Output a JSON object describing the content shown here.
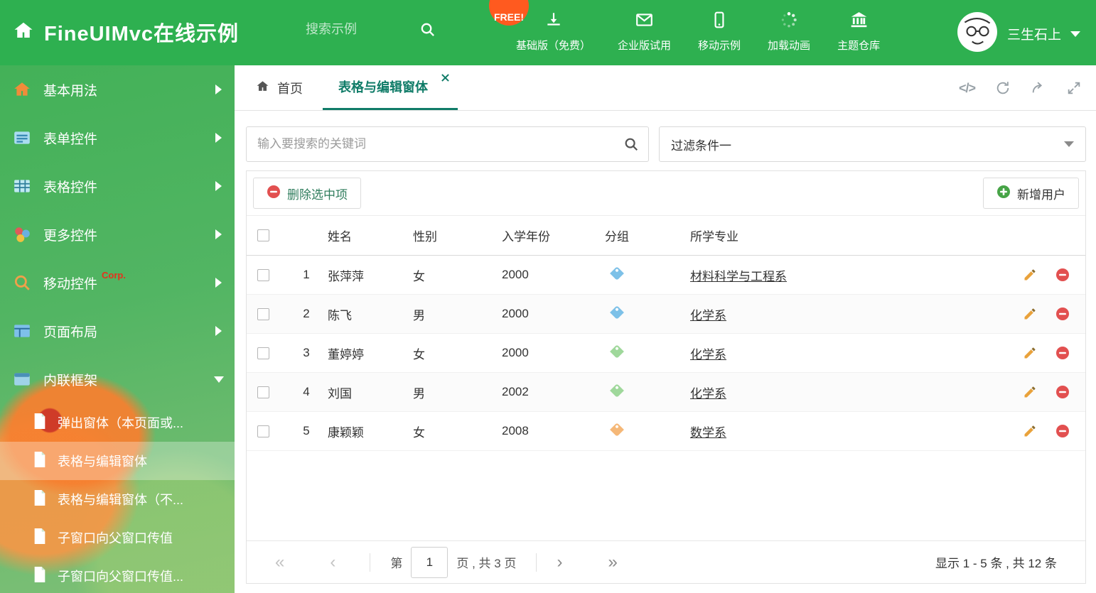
{
  "header": {
    "title": "FineUIMvc在线示例",
    "search_placeholder": "搜索示例",
    "free_badge": "FREE!",
    "nav": [
      {
        "label": "基础版（免费）",
        "icon": "download-icon"
      },
      {
        "label": "企业版试用",
        "icon": "envelope-icon"
      },
      {
        "label": "移动示例",
        "icon": "mobile-icon"
      },
      {
        "label": "加载动画",
        "icon": "spinner-icon"
      },
      {
        "label": "主题仓库",
        "icon": "bank-icon"
      }
    ],
    "user_name": "三生石上"
  },
  "sidebar": {
    "items": [
      {
        "label": "基本用法",
        "icon": "home-icon"
      },
      {
        "label": "表单控件",
        "icon": "form-icon"
      },
      {
        "label": "表格控件",
        "icon": "table-icon"
      },
      {
        "label": "更多控件",
        "icon": "widgets-icon"
      },
      {
        "label": "移动控件",
        "badge": "Corp.",
        "icon": "mobile-search-icon"
      },
      {
        "label": "页面布局",
        "icon": "layout-icon"
      },
      {
        "label": "内联框架",
        "icon": "iframe-icon",
        "expanded": true
      }
    ],
    "children": [
      {
        "label": "弹出窗体（本页面或..."
      },
      {
        "label": "表格与编辑窗体",
        "active": true
      },
      {
        "label": "表格与编辑窗体（不..."
      },
      {
        "label": "子窗口向父窗口传值"
      },
      {
        "label": "子窗口向父窗口传值..."
      }
    ]
  },
  "tabs": {
    "home": "首页",
    "active": "表格与编辑窗体"
  },
  "toolbar_icons": {
    "code_glyph": "</>"
  },
  "main": {
    "search_placeholder": "输入要搜索的关键词",
    "filter_value": "过滤条件一",
    "delete_button": "删除选中项",
    "add_button": "新增用户",
    "table": {
      "columns": {
        "name": "姓名",
        "gender": "性别",
        "year": "入学年份",
        "group": "分组",
        "major": "所学专业"
      },
      "rows": [
        {
          "index": "1",
          "name": "张萍萍",
          "gender": "女",
          "year": "2000",
          "tag_color": "#7dc1e8",
          "major": "材料科学与工程系"
        },
        {
          "index": "2",
          "name": "陈飞",
          "gender": "男",
          "year": "2000",
          "tag_color": "#7dc1e8",
          "major": "化学系"
        },
        {
          "index": "3",
          "name": "董婷婷",
          "gender": "女",
          "year": "2000",
          "tag_color": "#9fd89b",
          "major": "化学系"
        },
        {
          "index": "4",
          "name": "刘国",
          "gender": "男",
          "year": "2002",
          "tag_color": "#9fd89b",
          "major": "化学系"
        },
        {
          "index": "5",
          "name": "康颖颖",
          "gender": "女",
          "year": "2008",
          "tag_color": "#f5b878",
          "major": "数学系"
        }
      ]
    },
    "pagination": {
      "prefix": "第",
      "current_page": "1",
      "suffix": "页 , 共 3 页",
      "summary": "显示 1 - 5 条 , 共 12 条",
      "first_glyph": "«",
      "prev_glyph": "‹",
      "next_glyph": "›",
      "last_glyph": "»"
    }
  },
  "colors": {
    "header_green": "#2eb050",
    "active_tab_teal": "#107c68",
    "free_badge_orange": "#ff5a1f",
    "delete_red": "#e25050",
    "add_green": "#47a447",
    "pencil_orange": "#e9a23b"
  }
}
